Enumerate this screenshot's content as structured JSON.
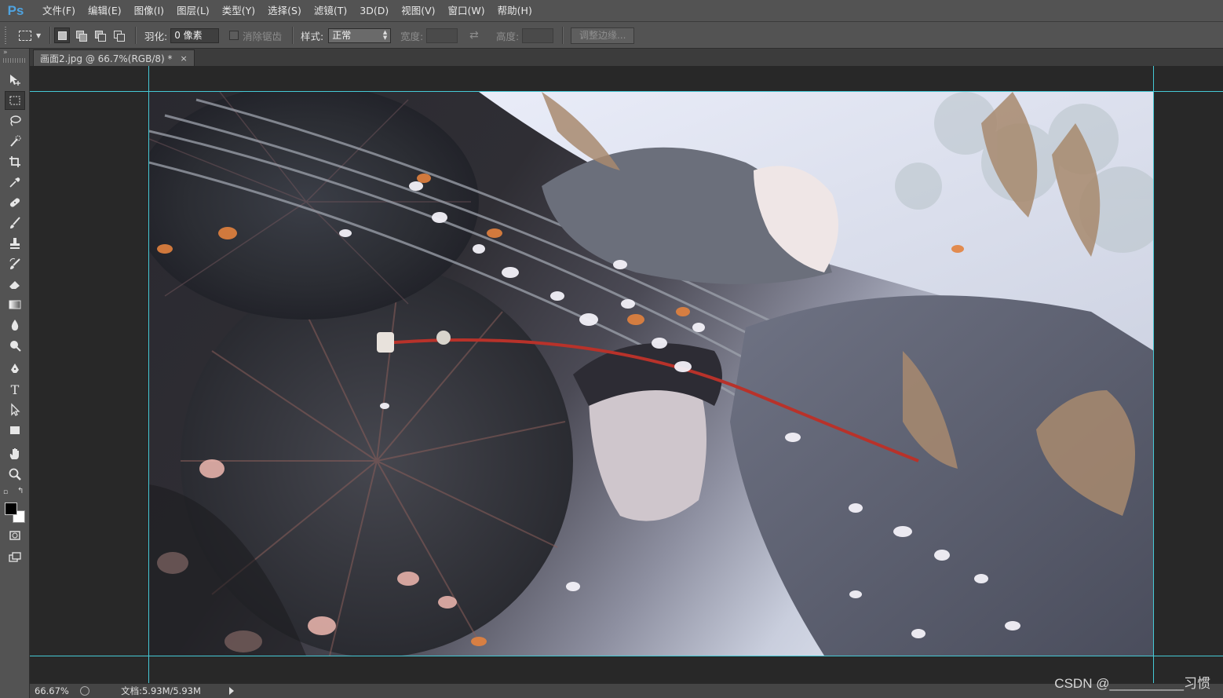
{
  "app": {
    "logo": "Ps"
  },
  "menu": [
    {
      "label": "文件(F)"
    },
    {
      "label": "编辑(E)"
    },
    {
      "label": "图像(I)"
    },
    {
      "label": "图层(L)"
    },
    {
      "label": "类型(Y)"
    },
    {
      "label": "选择(S)"
    },
    {
      "label": "滤镜(T)"
    },
    {
      "label": "3D(D)"
    },
    {
      "label": "视图(V)"
    },
    {
      "label": "窗口(W)"
    },
    {
      "label": "帮助(H)"
    }
  ],
  "options": {
    "feather_label": "羽化:",
    "feather_value": "0 像素",
    "antialias_label": "消除锯齿",
    "style_label": "样式:",
    "style_value": "正常",
    "width_label": "宽度:",
    "height_label": "高度:",
    "refine_edge": "调整边缘..."
  },
  "tools": [
    {
      "icon": "move-tool-icon"
    },
    {
      "icon": "rectangular-marquee-tool-icon",
      "active": true
    },
    {
      "icon": "lasso-tool-icon"
    },
    {
      "icon": "quick-selection-tool-icon"
    },
    {
      "icon": "crop-tool-icon"
    },
    {
      "icon": "eyedropper-tool-icon"
    },
    {
      "icon": "healing-brush-tool-icon"
    },
    {
      "icon": "brush-tool-icon"
    },
    {
      "icon": "clone-stamp-tool-icon"
    },
    {
      "icon": "history-brush-tool-icon"
    },
    {
      "icon": "eraser-tool-icon"
    },
    {
      "icon": "gradient-tool-icon"
    },
    {
      "icon": "blur-tool-icon"
    },
    {
      "icon": "dodge-tool-icon"
    },
    {
      "icon": "pen-tool-icon"
    },
    {
      "icon": "type-tool-icon"
    },
    {
      "icon": "path-selection-tool-icon"
    },
    {
      "icon": "rectangle-tool-icon"
    },
    {
      "icon": "hand-tool-icon"
    },
    {
      "icon": "zoom-tool-icon"
    }
  ],
  "colors": {
    "foreground": "#000000",
    "background": "#ffffff",
    "guide": "#45c9d6"
  },
  "document": {
    "tab_title": "画面2.jpg @ 66.7%(RGB/8) *",
    "close": "×"
  },
  "status": {
    "zoom": "66.67%",
    "doc_info": "文档:5.93M/5.93M"
  },
  "watermark": "CSDN @__________习惯"
}
